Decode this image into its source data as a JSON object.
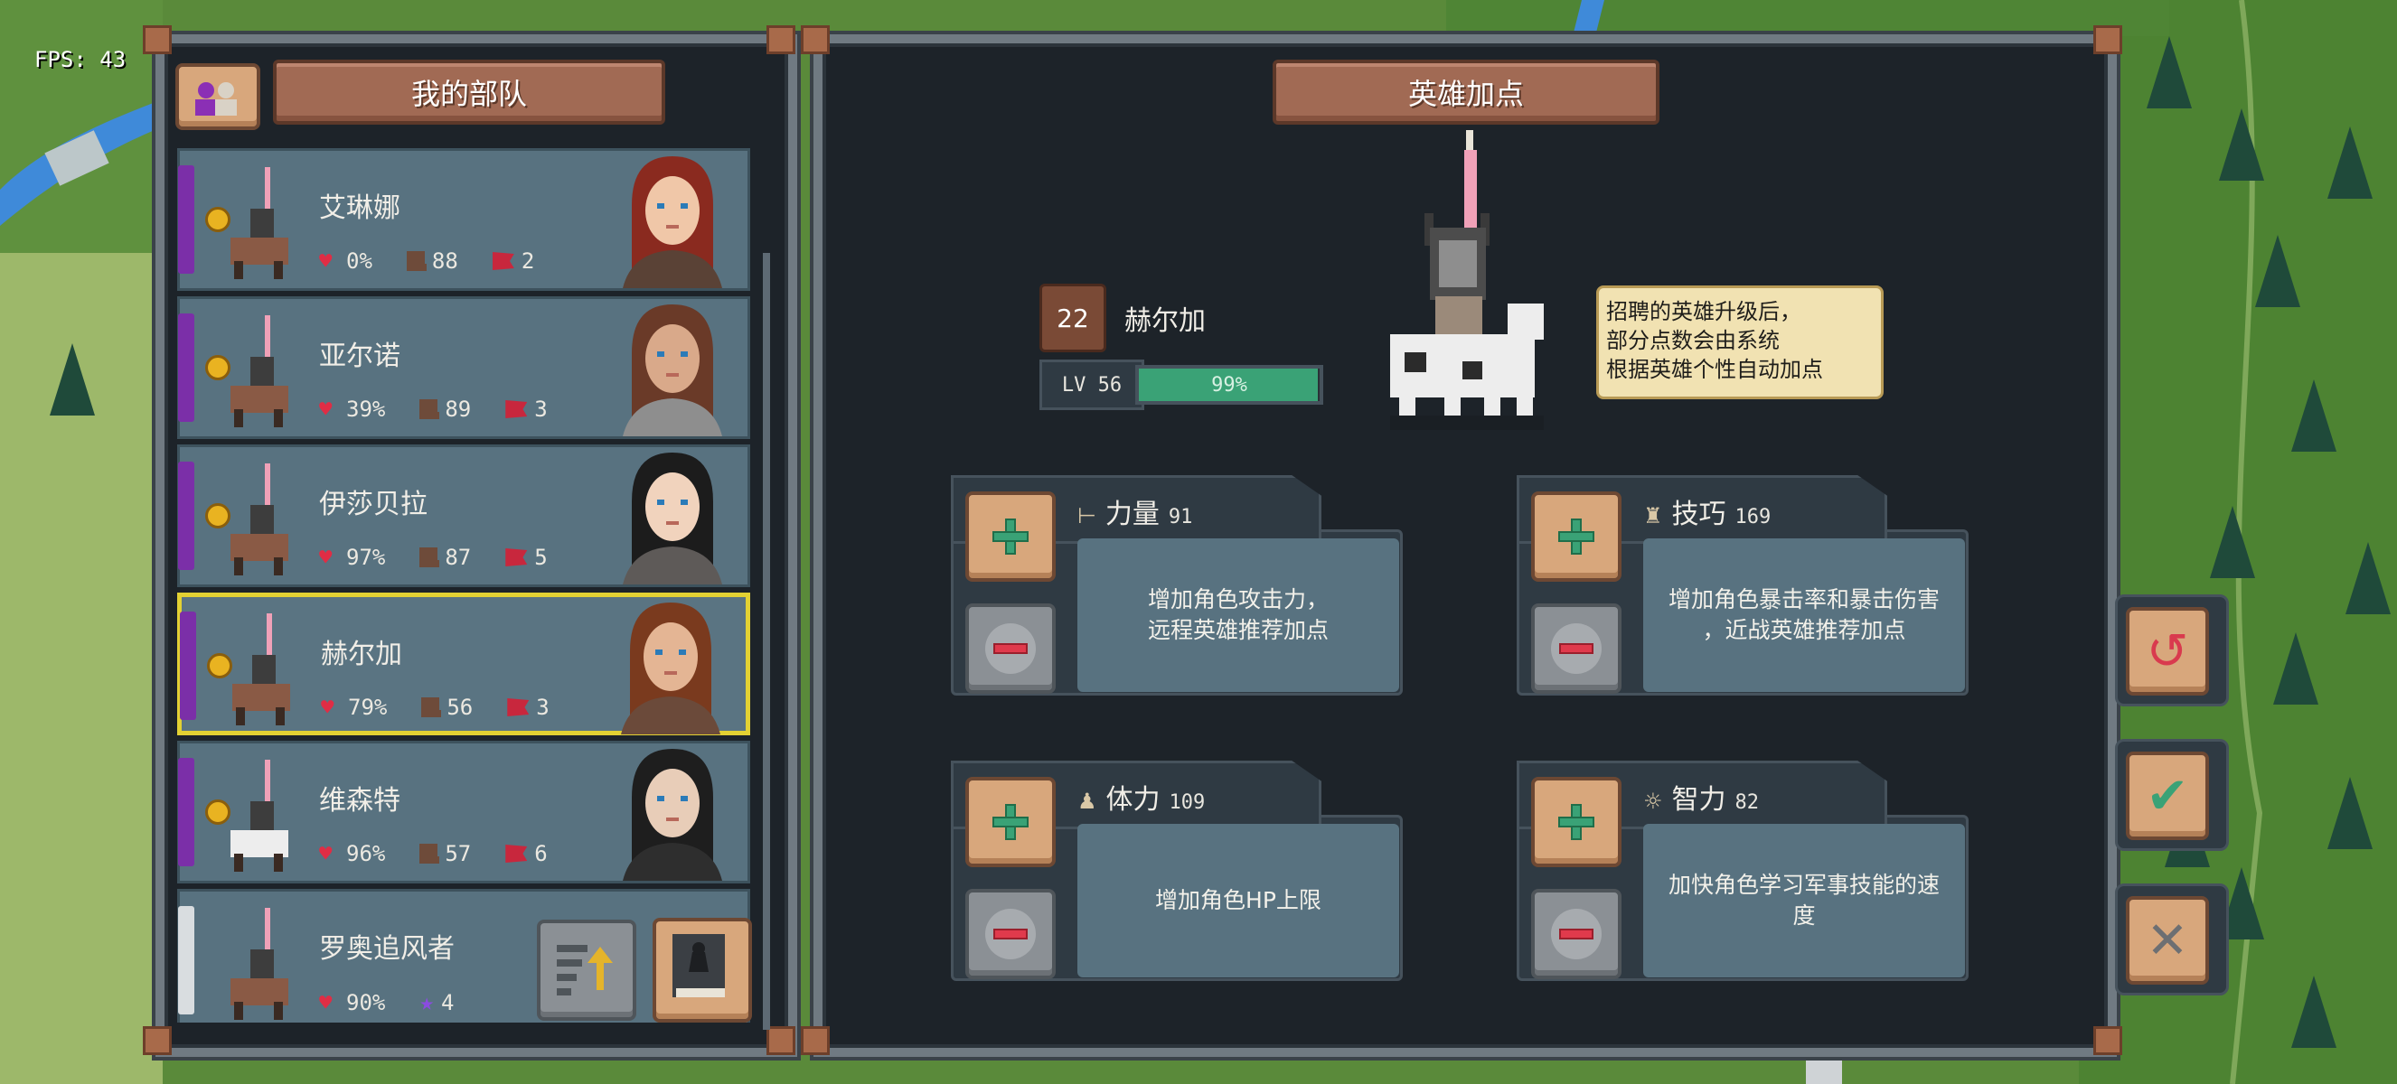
{
  "hud": {
    "fps": "FPS: 43"
  },
  "left_panel": {
    "title": "我的部队"
  },
  "heroes": [
    {
      "name": "艾琳娜",
      "hp": "0%",
      "speed": "88",
      "troops": "2",
      "selected": false
    },
    {
      "name": "亚尔诺",
      "hp": "39%",
      "speed": "89",
      "troops": "3",
      "selected": false
    },
    {
      "name": "伊莎贝拉",
      "hp": "97%",
      "speed": "87",
      "troops": "5",
      "selected": false
    },
    {
      "name": "赫尔加",
      "hp": "79%",
      "speed": "56",
      "troops": "3",
      "selected": true
    },
    {
      "name": "维森特",
      "hp": "96%",
      "speed": "57",
      "troops": "6",
      "selected": false
    },
    {
      "name": "罗奥追风者",
      "hp": "90%",
      "rank": "4",
      "selected": false
    }
  ],
  "right_panel": {
    "title": "英雄加点",
    "hero": {
      "points": "22",
      "name": "赫尔加",
      "level_label": "LV 56",
      "exp_percent": "99%",
      "exp_fraction": 0.99
    },
    "tooltip": "招聘的英雄升级后，\n部分点数会由系统\n根据英雄个性自动加点",
    "attributes": [
      {
        "name": "力量",
        "value": "91",
        "icon": "sword-icon",
        "glyph": "⊢",
        "desc": "增加角色攻击力，\n远程英雄推荐加点"
      },
      {
        "name": "技巧",
        "value": "169",
        "icon": "dagger-icon",
        "glyph": "♜",
        "desc": "增加角色暴击率和暴击伤害\n，近战英雄推荐加点"
      },
      {
        "name": "体力",
        "value": "109",
        "icon": "armor-icon",
        "glyph": "♟",
        "desc": "增加角色HP上限"
      },
      {
        "name": "智力",
        "value": "82",
        "icon": "brain-icon",
        "glyph": "☼",
        "desc": "加快角色学习军事技能的速\n度"
      }
    ]
  },
  "side_buttons": [
    {
      "name": "reset-icon",
      "glyph": "↺",
      "color": "#d93a4e"
    },
    {
      "name": "confirm-icon",
      "glyph": "✔",
      "color": "#3aa276"
    },
    {
      "name": "close-icon",
      "glyph": "✕",
      "color": "#6d6f72"
    }
  ],
  "colors": {
    "accent_gold": "#e3d133",
    "plate": "#a16a54",
    "card": "#587280"
  }
}
